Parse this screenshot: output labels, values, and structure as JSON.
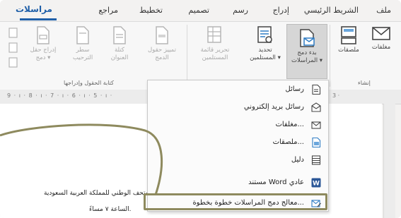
{
  "tabs": [
    {
      "label": "ملف"
    },
    {
      "label": "الشريط الرئيسي"
    },
    {
      "label": "إدراج"
    },
    {
      "label": "رسم"
    },
    {
      "label": "تصميم"
    },
    {
      "label": "تخطيط"
    },
    {
      "label": "مراجع"
    },
    {
      "label": "مراسلات"
    }
  ],
  "ribbon": {
    "create_group": {
      "label": "إنشاء",
      "envelopes": "مغلفات",
      "labels": "ملصقات"
    },
    "start_merge_group": {
      "start_merge_line1": "بدء دمج",
      "start_merge_line2": "المراسلات ▾",
      "select_recipients_line1": "تحديد",
      "select_recipients_line2": "المستلمين ▾",
      "edit_list_line1": "تحرير قائمة",
      "edit_list_line2": "المستلمين"
    },
    "write_group": {
      "label": "كتابة الحقول وإدراجها",
      "highlight_line1": "تمييز حقول",
      "highlight_line2": "الدمج",
      "address_line1": "كتلة",
      "address_line2": "العنوان",
      "greeting_line1": "سطر",
      "greeting_line2": "الترحيب",
      "insert_line1": "إدراج حقل",
      "insert_line2": "دمج ▾"
    }
  },
  "ruler": {
    "numbers": "9 · ı · 8 · ı · 7 · ı · 6 · ı · 5 · ı ·",
    "right_mark": "3 ·"
  },
  "document": {
    "line1": "في المتحف الوطني للمملكة العربية السعودية",
    "line2": "الساعة ٧ مساءً."
  },
  "menu": {
    "items": [
      {
        "label": "رسائل",
        "icon": "letter-icon"
      },
      {
        "label": "رسائل بريد إلكتروني",
        "icon": "email-icon"
      },
      {
        "label": "مغلفات...",
        "icon": "envelope-icon"
      },
      {
        "label": "ملصقات...",
        "icon": "label-icon"
      },
      {
        "label": "دليل",
        "icon": "directory-icon"
      },
      {
        "label": "مستند Word عادي",
        "icon": "word-document-icon"
      },
      {
        "label": "معالج دمج المراسلات خطوة بخطوة...",
        "icon": "wizard-icon"
      }
    ]
  },
  "colors": {
    "accent": "#1f5fa8",
    "highlight_border": "#8e8a5e"
  }
}
